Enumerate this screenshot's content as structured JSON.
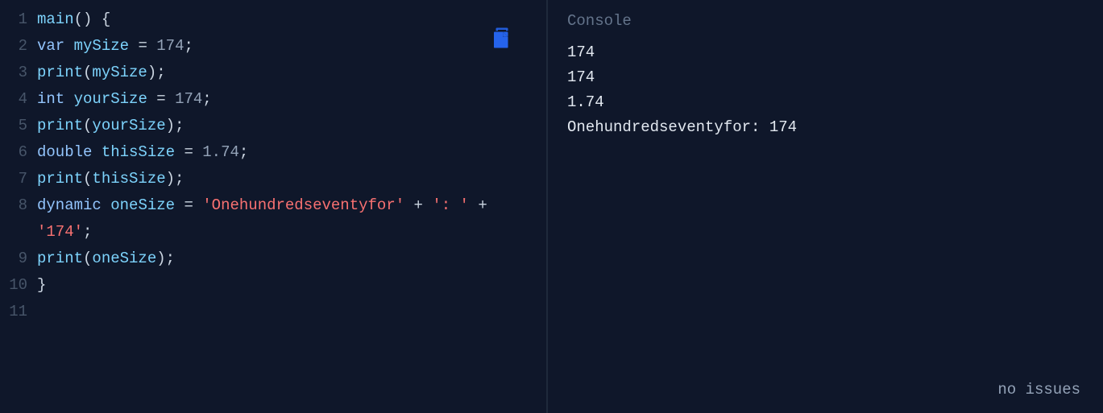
{
  "editor": {
    "lines": [
      {
        "n": "1",
        "tokens": [
          {
            "t": "main",
            "c": "tok-fn"
          },
          {
            "t": "() {",
            "c": "tok-pun"
          }
        ]
      },
      {
        "n": "2",
        "tokens": [
          {
            "t": "var",
            "c": "tok-kw"
          },
          {
            "t": " ",
            "c": "tok-pun"
          },
          {
            "t": "mySize",
            "c": "tok-id"
          },
          {
            "t": " = ",
            "c": "tok-pun"
          },
          {
            "t": "174",
            "c": "tok-num"
          },
          {
            "t": ";",
            "c": "tok-pun"
          }
        ]
      },
      {
        "n": "3",
        "tokens": [
          {
            "t": "print",
            "c": "tok-fn"
          },
          {
            "t": "(",
            "c": "tok-pun"
          },
          {
            "t": "mySize",
            "c": "tok-id"
          },
          {
            "t": ");",
            "c": "tok-pun"
          }
        ]
      },
      {
        "n": "4",
        "tokens": [
          {
            "t": "int",
            "c": "tok-kw"
          },
          {
            "t": " ",
            "c": "tok-pun"
          },
          {
            "t": "yourSize",
            "c": "tok-id"
          },
          {
            "t": " = ",
            "c": "tok-pun"
          },
          {
            "t": "174",
            "c": "tok-num"
          },
          {
            "t": ";",
            "c": "tok-pun"
          }
        ]
      },
      {
        "n": "5",
        "tokens": [
          {
            "t": "print",
            "c": "tok-fn"
          },
          {
            "t": "(",
            "c": "tok-pun"
          },
          {
            "t": "yourSize",
            "c": "tok-id"
          },
          {
            "t": ");",
            "c": "tok-pun"
          }
        ]
      },
      {
        "n": "6",
        "tokens": [
          {
            "t": "double",
            "c": "tok-kw"
          },
          {
            "t": " ",
            "c": "tok-pun"
          },
          {
            "t": "thisSize",
            "c": "tok-id"
          },
          {
            "t": " = ",
            "c": "tok-pun"
          },
          {
            "t": "1.74",
            "c": "tok-num"
          },
          {
            "t": ";",
            "c": "tok-pun"
          }
        ]
      },
      {
        "n": "7",
        "tokens": [
          {
            "t": "print",
            "c": "tok-fn"
          },
          {
            "t": "(",
            "c": "tok-pun"
          },
          {
            "t": "thisSize",
            "c": "tok-id"
          },
          {
            "t": ");",
            "c": "tok-pun"
          }
        ]
      },
      {
        "n": "8",
        "tokens": [
          {
            "t": "dynamic",
            "c": "tok-kw"
          },
          {
            "t": " ",
            "c": "tok-pun"
          },
          {
            "t": "oneSize",
            "c": "tok-id"
          },
          {
            "t": " = ",
            "c": "tok-pun"
          },
          {
            "t": "'Onehundredseventyfor'",
            "c": "tok-str"
          },
          {
            "t": " + ",
            "c": "tok-op"
          },
          {
            "t": "': '",
            "c": "tok-str"
          },
          {
            "t": " + ",
            "c": "tok-op"
          },
          {
            "t": "'174'",
            "c": "tok-str"
          },
          {
            "t": ";",
            "c": "tok-pun"
          }
        ]
      },
      {
        "n": "9",
        "tokens": [
          {
            "t": "print",
            "c": "tok-fn"
          },
          {
            "t": "(",
            "c": "tok-pun"
          },
          {
            "t": "oneSize",
            "c": "tok-id"
          },
          {
            "t": ");",
            "c": "tok-pun"
          }
        ]
      },
      {
        "n": "10",
        "tokens": [
          {
            "t": "}",
            "c": "tok-pun"
          }
        ]
      },
      {
        "n": "11",
        "tokens": []
      }
    ]
  },
  "console": {
    "title": "Console",
    "lines": [
      "174",
      "174",
      "1.74",
      "Onehundredseventyfor: 174"
    ],
    "status": "no issues"
  },
  "icons": {
    "copy": "copy-icon"
  }
}
